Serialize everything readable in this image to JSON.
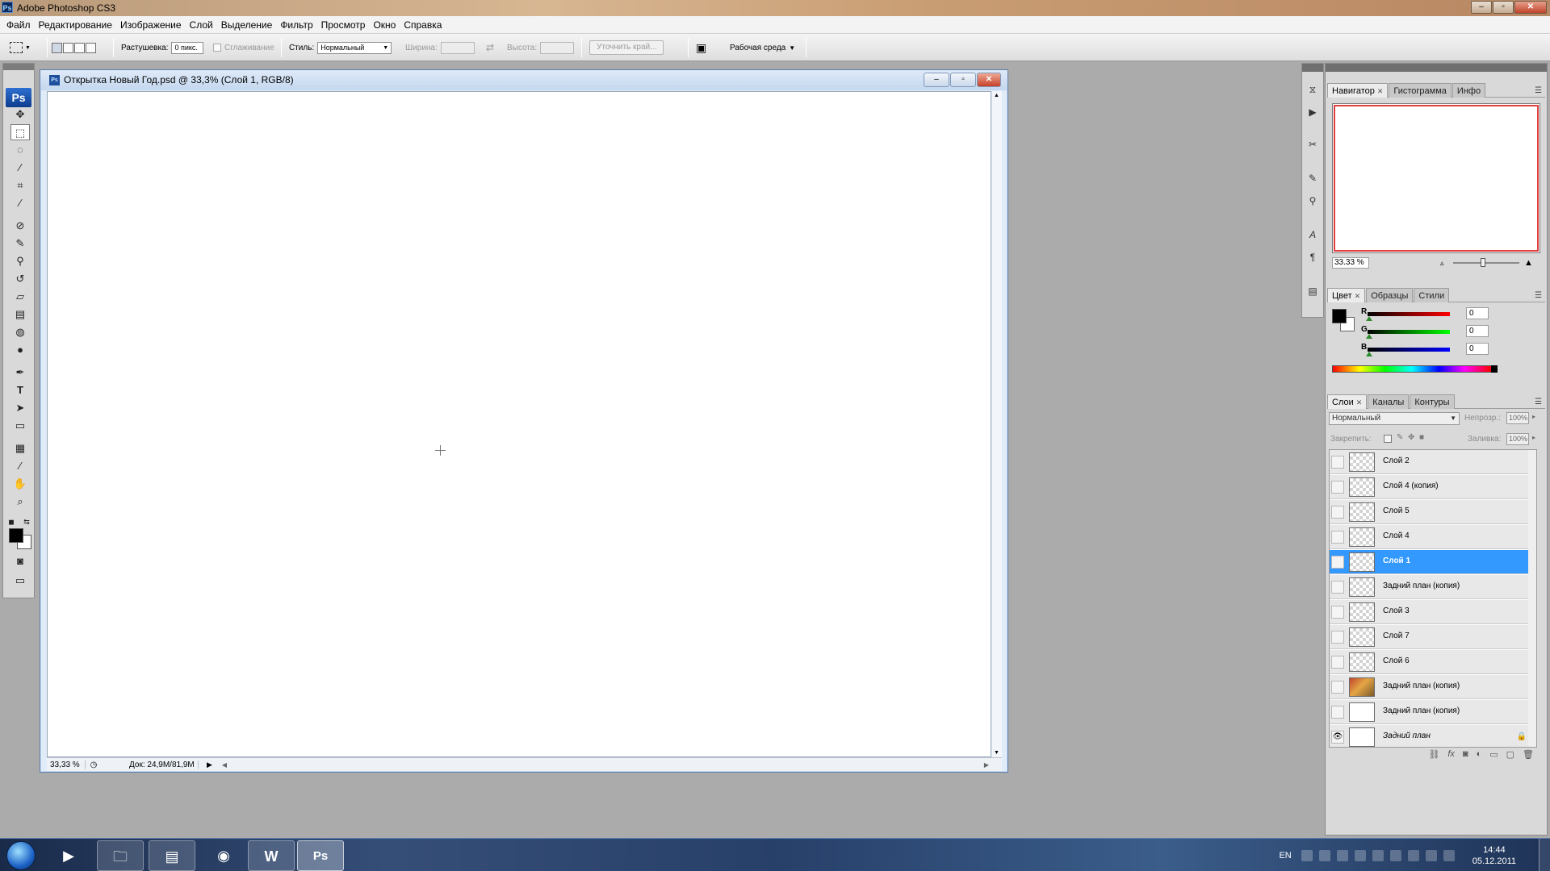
{
  "app": {
    "title": "Adobe Photoshop CS3",
    "icon": "ps-app-icon",
    "badge": "Ps"
  },
  "menu": [
    "Файл",
    "Редактирование",
    "Изображение",
    "Слой",
    "Выделение",
    "Фильтр",
    "Просмотр",
    "Окно",
    "Справка"
  ],
  "options": {
    "feather_label": "Растушевка:",
    "feather_value": "0 пикс.",
    "antialias_label": "Сглаживание",
    "style_label": "Стиль:",
    "style_value": "Нормальный",
    "width_label": "Ширина:",
    "height_label": "Высота:",
    "refine_edge": "Уточнить край...",
    "workspace": "Рабочая среда"
  },
  "document": {
    "title": "Открытка Новый Год.psd @ 33,3% (Слой 1, RGB/8)",
    "zoom": "33,33 %",
    "doc_size": "Док: 24,9M/81,9M"
  },
  "navigator": {
    "tabs": [
      "Навигатор",
      "Гистограмма",
      "Инфо"
    ],
    "zoom": "33.33 %",
    "proxy_color": "#e0403f"
  },
  "color": {
    "tabs": [
      "Цвет",
      "Образцы",
      "Стили"
    ],
    "r_label": "R",
    "g_label": "G",
    "b_label": "B",
    "r": "0",
    "g": "0",
    "b": "0",
    "foreground": "#000000",
    "background": "#ffffff"
  },
  "layers": {
    "tabs": [
      "Слои",
      "Каналы",
      "Контуры"
    ],
    "blend_mode": "Нормальный",
    "opacity_label": "Непрозр.:",
    "opacity": "100%",
    "lock_label": "Закрепить:",
    "fill_label": "Заливка:",
    "fill": "100%",
    "selected_color": "#3399ff",
    "items": [
      {
        "name": "Слой 2",
        "visible": false,
        "thumb": "transparent"
      },
      {
        "name": "Слой 4 (копия)",
        "visible": false,
        "thumb": "transparent"
      },
      {
        "name": "Слой 5",
        "visible": false,
        "thumb": "transparent"
      },
      {
        "name": "Слой 4",
        "visible": false,
        "thumb": "transparent"
      },
      {
        "name": "Слой 1",
        "visible": false,
        "thumb": "transparent",
        "selected": true
      },
      {
        "name": "Задний план (копия)",
        "visible": false,
        "thumb": "transparent"
      },
      {
        "name": "Слой 3",
        "visible": false,
        "thumb": "transparent"
      },
      {
        "name": "Слой 7",
        "visible": false,
        "thumb": "transparent"
      },
      {
        "name": "Слой 6",
        "visible": false,
        "thumb": "transparent"
      },
      {
        "name": "Задний план (копия)",
        "visible": false,
        "thumb": "photo"
      },
      {
        "name": "Задний план (копия)",
        "visible": false,
        "thumb": "plain"
      },
      {
        "name": "Задний план",
        "visible": true,
        "thumb": "plain",
        "locked": true
      }
    ]
  },
  "taskbar": {
    "lang": "EN",
    "time": "14:44",
    "date": "05.12.2011"
  }
}
